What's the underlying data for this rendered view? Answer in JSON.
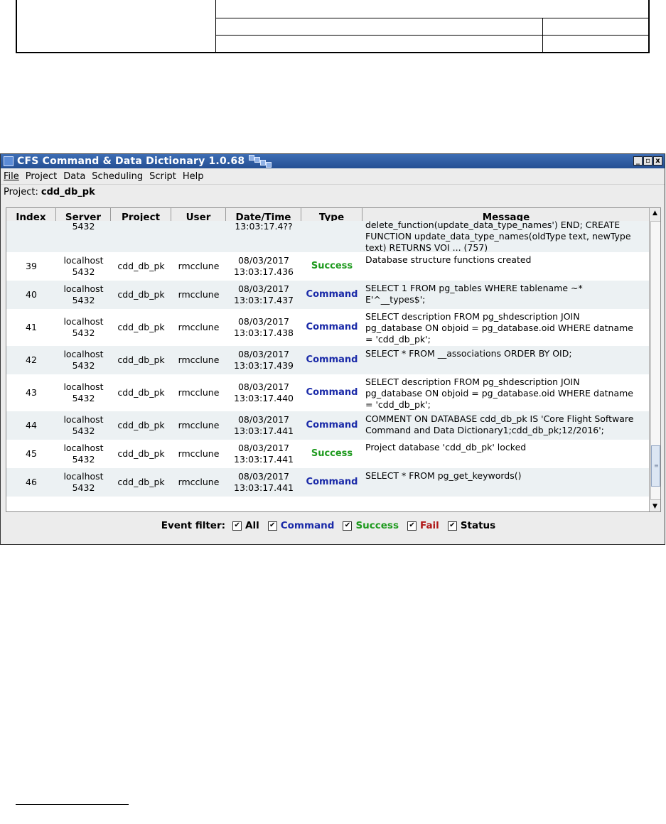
{
  "window": {
    "title": "CFS Command & Data Dictionary  1.0.68",
    "controls": [
      "_",
      "▫",
      "x"
    ]
  },
  "menu": [
    "File",
    "Project",
    "Data",
    "Scheduling",
    "Script",
    "Help"
  ],
  "project": {
    "label": "Project:",
    "name": "cdd_db_pk"
  },
  "table": {
    "columns": [
      "Index",
      "Server",
      "Project",
      "User",
      "Date/Time",
      "Type",
      "Message"
    ],
    "partial_row": {
      "server": "5432",
      "datetime": "13:03:17.4??",
      "message_lines": [
        "delete_function(update_data_type_names') END; CREATE",
        "FUNCTION update_data_type_names(oldType text, newType",
        "text) RETURNS VOI ... (757)"
      ]
    },
    "rows": [
      {
        "index": "39",
        "server": "localhost\n5432",
        "project": "cdd_db_pk",
        "user": "rmcclune",
        "date": "08/03/2017",
        "time": "13:03:17.436",
        "type": "Success",
        "message": "Database structure functions created"
      },
      {
        "index": "40",
        "server": "localhost\n5432",
        "project": "cdd_db_pk",
        "user": "rmcclune",
        "date": "08/03/2017",
        "time": "13:03:17.437",
        "type": "Command",
        "message": "SELECT 1 FROM pg_tables WHERE tablename ~*\nE'^__types$';"
      },
      {
        "index": "41",
        "server": "localhost\n5432",
        "project": "cdd_db_pk",
        "user": "rmcclune",
        "date": "08/03/2017",
        "time": "13:03:17.438",
        "type": "Command",
        "message": "SELECT description FROM pg_shdescription JOIN\npg_database ON objoid = pg_database.oid WHERE datname\n= 'cdd_db_pk';"
      },
      {
        "index": "42",
        "server": "localhost\n5432",
        "project": "cdd_db_pk",
        "user": "rmcclune",
        "date": "08/03/2017",
        "time": "13:03:17.439",
        "type": "Command",
        "message": "SELECT * FROM __associations ORDER BY OID;"
      },
      {
        "index": "43",
        "server": "localhost\n5432",
        "project": "cdd_db_pk",
        "user": "rmcclune",
        "date": "08/03/2017",
        "time": "13:03:17.440",
        "type": "Command",
        "message": "SELECT description FROM pg_shdescription JOIN\npg_database ON objoid = pg_database.oid WHERE datname\n= 'cdd_db_pk';"
      },
      {
        "index": "44",
        "server": "localhost\n5432",
        "project": "cdd_db_pk",
        "user": "rmcclune",
        "date": "08/03/2017",
        "time": "13:03:17.441",
        "type": "Command",
        "message": "COMMENT ON DATABASE cdd_db_pk IS 'Core Flight Software\nCommand and Data Dictionary1;cdd_db_pk;12/2016';"
      },
      {
        "index": "45",
        "server": "localhost\n5432",
        "project": "cdd_db_pk",
        "user": "rmcclune",
        "date": "08/03/2017",
        "time": "13:03:17.441",
        "type": "Success",
        "message": "Project database 'cdd_db_pk' locked"
      },
      {
        "index": "46",
        "server": "localhost\n5432",
        "project": "cdd_db_pk",
        "user": "rmcclune",
        "date": "08/03/2017",
        "time": "13:03:17.441",
        "type": "Command",
        "message": "SELECT * FROM pg_get_keywords()"
      }
    ]
  },
  "filter": {
    "label": "Event filter:",
    "options": [
      {
        "label": "All",
        "checked": true
      },
      {
        "label": "Command",
        "checked": true
      },
      {
        "label": "Success",
        "checked": true
      },
      {
        "label": "Fail",
        "checked": true
      },
      {
        "label": "Status",
        "checked": true
      }
    ]
  },
  "colors": {
    "titlebar": "#2f5ea6",
    "command": "#1a2aa8",
    "success": "#1e9a1e",
    "fail": "#b01818",
    "row_alt": "#ecf1f3"
  }
}
